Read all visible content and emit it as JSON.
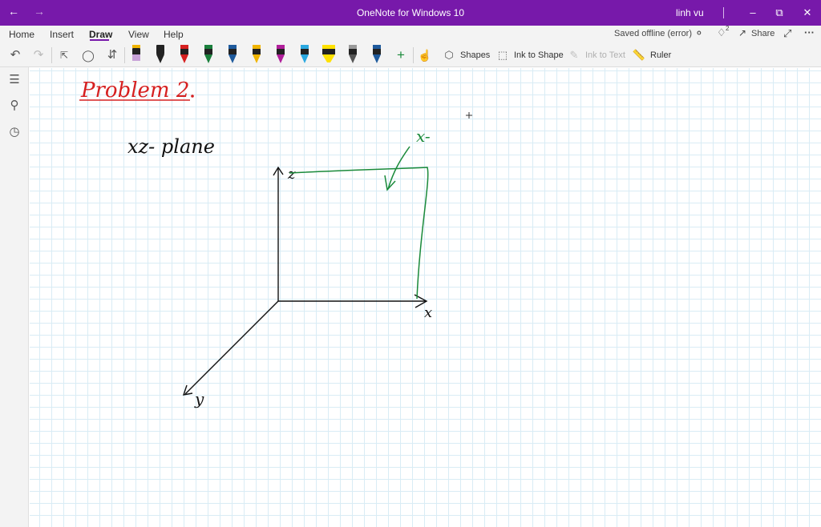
{
  "window": {
    "title": "OneNote for Windows 10",
    "user": "linh vu"
  },
  "menu": {
    "items": [
      "Home",
      "Insert",
      "Draw",
      "View",
      "Help"
    ],
    "active": "Draw",
    "status": "Saved offline (error)",
    "notification_count": "2",
    "share_label": "Share"
  },
  "toolbar": {
    "shapes_label": "Shapes",
    "ink_to_shape_label": "Ink to Shape",
    "ink_to_text_label": "Ink to Text",
    "ruler_label": "Ruler",
    "pen_colors": [
      "#c8a2d8",
      "#222222",
      "#d62020",
      "#1a7f3c",
      "#1e5a9c",
      "#f0b400",
      "#b01f9a",
      "#2aa8e0",
      "#ffe100",
      "#555555",
      "#1e5a9c"
    ]
  },
  "note": {
    "heading": "Problem 2",
    "label_plane": "xz- plane",
    "axis_x": "x",
    "axis_y": "y",
    "axis_z": "z",
    "label_green": "x-",
    "colors": {
      "heading": "#d62020",
      "ink": "#111111",
      "green": "#1a8a3a"
    }
  },
  "icons": {
    "back": "back-arrow-icon",
    "forward": "forward-arrow-icon",
    "undo": "undo-icon",
    "redo": "redo-icon",
    "lightbulb": "lightbulb-icon",
    "bell": "bell-icon",
    "notebooks": "notebooks-icon",
    "search": "search-icon",
    "recent": "clock-icon"
  }
}
